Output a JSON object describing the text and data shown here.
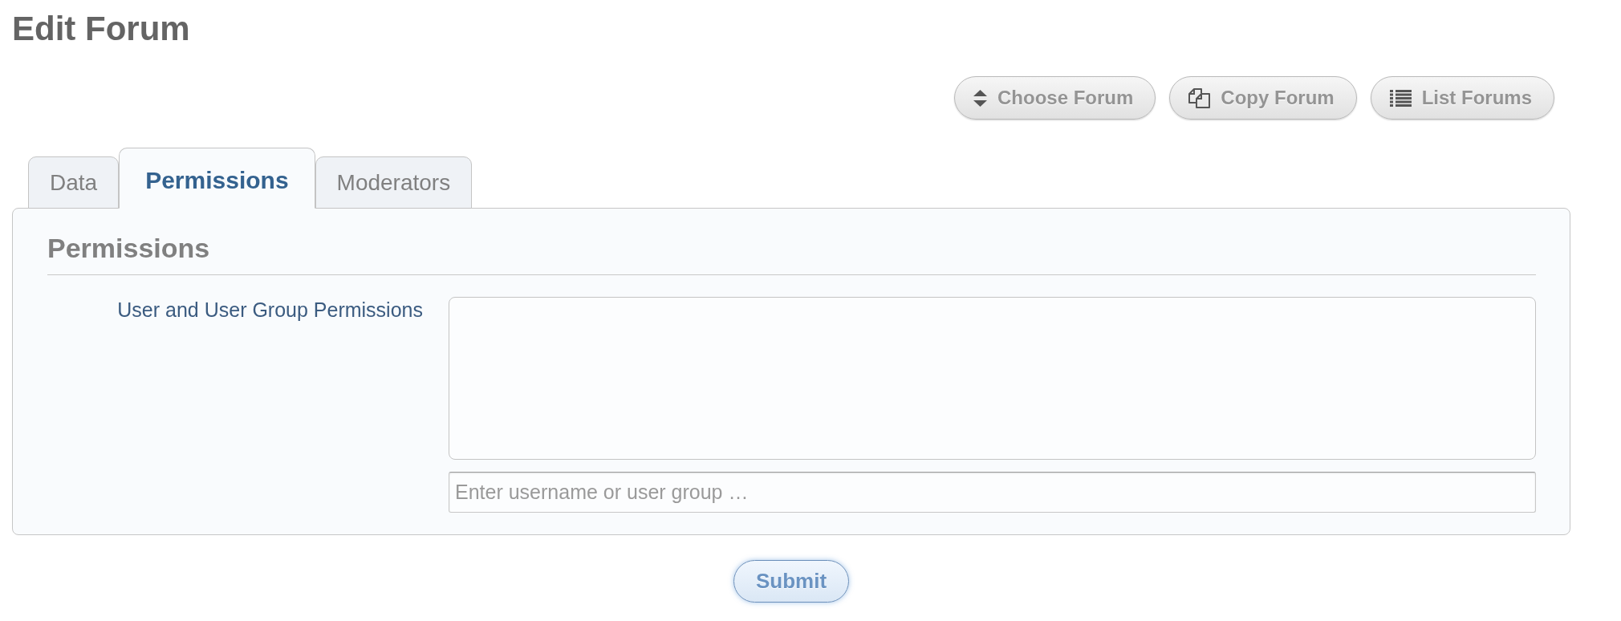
{
  "page": {
    "title": "Edit Forum"
  },
  "actions": [
    {
      "kind": "choose",
      "label": "Choose Forum"
    },
    {
      "kind": "copy",
      "label": "Copy Forum"
    },
    {
      "kind": "list",
      "label": "List Forums"
    }
  ],
  "tabs": [
    {
      "label": "Data",
      "selected": false
    },
    {
      "label": "Permissions",
      "selected": true
    },
    {
      "label": "Moderators",
      "selected": false
    }
  ],
  "section": {
    "heading": "Permissions",
    "fields": [
      {
        "label": "User and User Group Permissions",
        "placeholder": "Enter username or user group …"
      }
    ]
  },
  "submit": {
    "label": "Submit"
  }
}
